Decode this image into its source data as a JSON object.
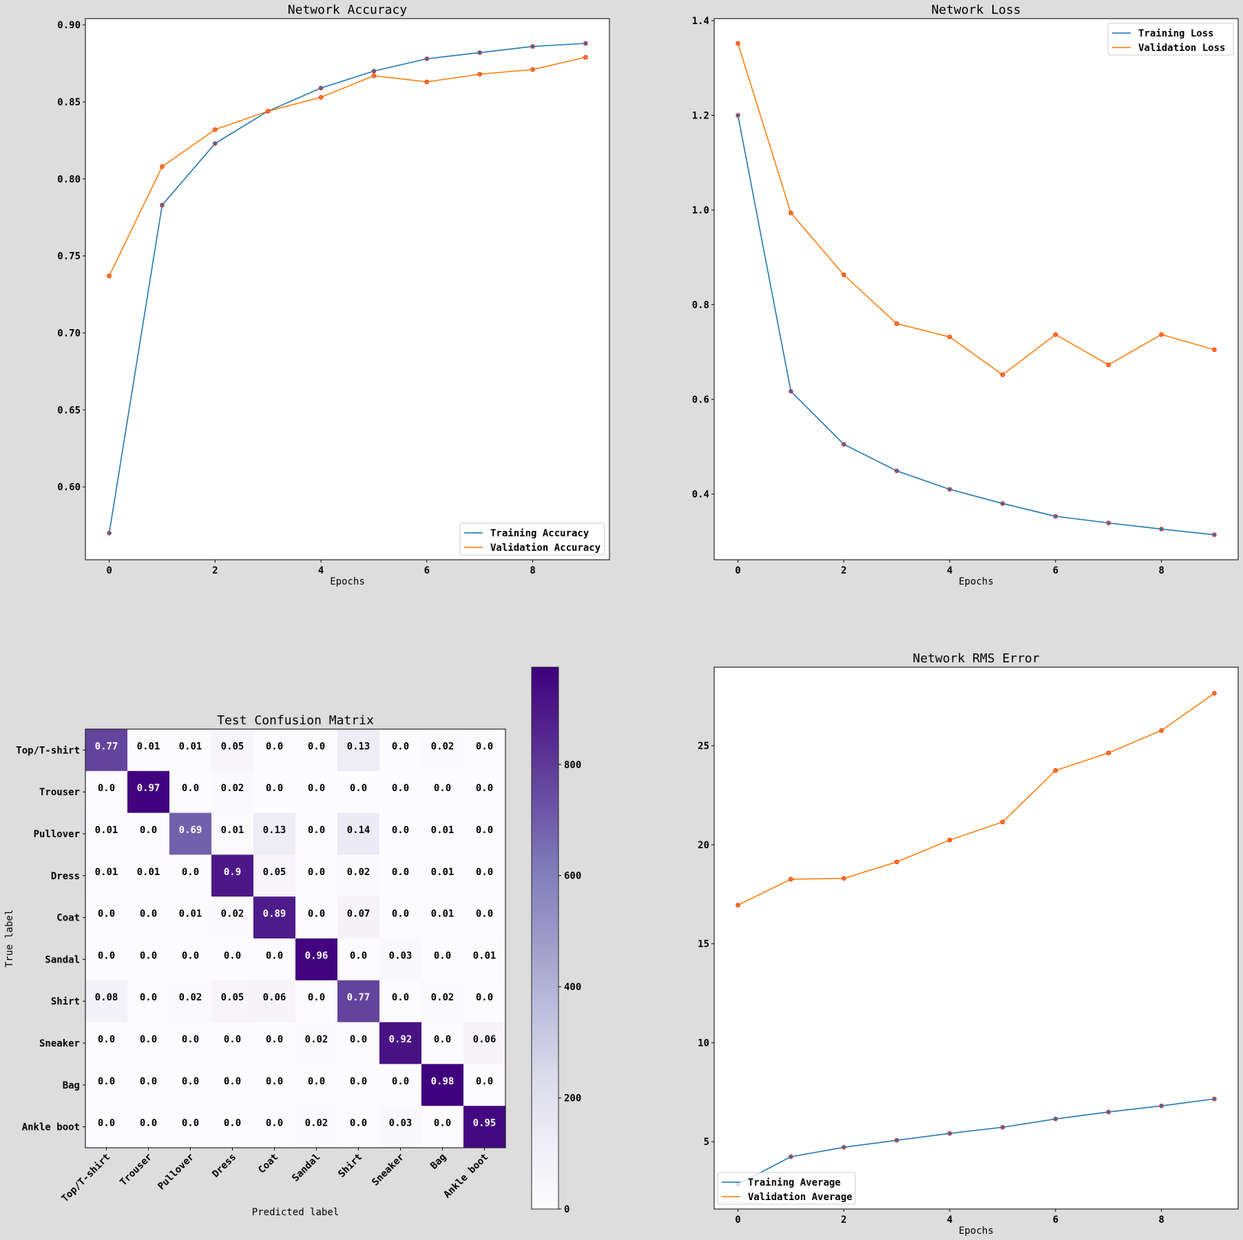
{
  "colors": {
    "background": "#dddddd",
    "training": "#1f77b4",
    "validation": "#ff7f0e",
    "marker": "#ff2a1a",
    "cmap_low": "#fcfbfd",
    "cmap_high": "#3f007d"
  },
  "chart_data": [
    {
      "id": "accuracy",
      "type": "line",
      "title": "Network Accuracy",
      "xlabel": "Epochs",
      "ylabel": "",
      "x": [
        0,
        1,
        2,
        3,
        4,
        5,
        6,
        7,
        8,
        9
      ],
      "xlim": [
        -0.45,
        9.45
      ],
      "ylim": [
        0.5527,
        0.9041
      ],
      "xticks": [
        0,
        2,
        4,
        6,
        8
      ],
      "yticks": [
        0.6,
        0.65,
        0.7,
        0.75,
        0.8,
        0.85,
        0.9
      ],
      "ytick_labels": [
        "0.60",
        "0.65",
        "0.70",
        "0.75",
        "0.80",
        "0.85",
        "0.90"
      ],
      "legend_position": "lower-right",
      "grid": false,
      "series": [
        {
          "name": "Training Accuracy",
          "color_key": "training",
          "values": [
            0.57,
            0.783,
            0.823,
            0.844,
            0.859,
            0.87,
            0.878,
            0.882,
            0.886,
            0.888
          ]
        },
        {
          "name": "Validation Accuracy",
          "color_key": "validation",
          "values": [
            0.737,
            0.808,
            0.832,
            0.844,
            0.853,
            0.867,
            0.863,
            0.868,
            0.871,
            0.879
          ]
        }
      ]
    },
    {
      "id": "loss",
      "type": "line",
      "title": "Network Loss",
      "xlabel": "Epochs",
      "ylabel": "",
      "x": [
        0,
        1,
        2,
        3,
        4,
        5,
        6,
        7,
        8,
        9
      ],
      "xlim": [
        -0.45,
        9.45
      ],
      "ylim": [
        0.2612,
        1.4044
      ],
      "xticks": [
        0,
        2,
        4,
        6,
        8
      ],
      "yticks": [
        0.4,
        0.6,
        0.8,
        1.0,
        1.2,
        1.4
      ],
      "ytick_labels": [
        "0.4",
        "0.6",
        "0.8",
        "1.0",
        "1.2",
        "1.4"
      ],
      "legend_position": "upper-right",
      "grid": false,
      "series": [
        {
          "name": "Training Loss",
          "color_key": "training",
          "values": [
            1.2,
            0.617,
            0.505,
            0.449,
            0.41,
            0.38,
            0.353,
            0.339,
            0.326,
            0.314
          ]
        },
        {
          "name": "Validation Loss",
          "color_key": "validation",
          "values": [
            1.352,
            0.994,
            0.863,
            0.76,
            0.732,
            0.652,
            0.737,
            0.673,
            0.737,
            0.705
          ]
        }
      ]
    },
    {
      "id": "rms",
      "type": "line",
      "title": "Network RMS Error",
      "xlabel": "Epochs",
      "ylabel": "",
      "x": [
        0,
        1,
        2,
        3,
        4,
        5,
        6,
        7,
        8,
        9
      ],
      "xlim": [
        -0.45,
        9.45
      ],
      "ylim": [
        1.6,
        28.97
      ],
      "xticks": [
        0,
        2,
        4,
        6,
        8
      ],
      "yticks": [
        5,
        10,
        15,
        20,
        25
      ],
      "ytick_labels": [
        "5",
        "10",
        "15",
        "20",
        "25"
      ],
      "legend_position": "lower-left",
      "grid": false,
      "series": [
        {
          "name": "Training Average",
          "color_key": "training",
          "values": [
            2.85,
            4.24,
            4.72,
            5.07,
            5.42,
            5.73,
            6.15,
            6.5,
            6.81,
            7.16
          ]
        },
        {
          "name": "Validation Average",
          "color_key": "validation",
          "values": [
            16.95,
            18.26,
            18.3,
            19.13,
            20.24,
            21.15,
            23.75,
            24.64,
            25.77,
            27.65
          ]
        }
      ]
    },
    {
      "id": "confusion",
      "type": "heatmap",
      "title": "Test Confusion Matrix",
      "xlabel": "Predicted label",
      "ylabel": "True label",
      "labels": [
        "Top/T-shirt",
        "Trouser",
        "Pullover",
        "Dress",
        "Coat",
        "Sandal",
        "Shirt",
        "Sneaker",
        "Bag",
        "Ankle boot"
      ],
      "matrix": [
        [
          "0.77",
          "0.01",
          "0.01",
          "0.05",
          "0.0",
          "0.0",
          "0.13",
          "0.0",
          "0.02",
          "0.0"
        ],
        [
          "0.0",
          "0.97",
          "0.0",
          "0.02",
          "0.0",
          "0.0",
          "0.0",
          "0.0",
          "0.0",
          "0.0"
        ],
        [
          "0.01",
          "0.0",
          "0.69",
          "0.01",
          "0.13",
          "0.0",
          "0.14",
          "0.0",
          "0.01",
          "0.0"
        ],
        [
          "0.01",
          "0.01",
          "0.0",
          "0.9",
          "0.05",
          "0.0",
          "0.02",
          "0.0",
          "0.01",
          "0.0"
        ],
        [
          "0.0",
          "0.0",
          "0.01",
          "0.02",
          "0.89",
          "0.0",
          "0.07",
          "0.0",
          "0.01",
          "0.0"
        ],
        [
          "0.0",
          "0.0",
          "0.0",
          "0.0",
          "0.0",
          "0.96",
          "0.0",
          "0.03",
          "0.0",
          "0.01"
        ],
        [
          "0.08",
          "0.0",
          "0.02",
          "0.05",
          "0.06",
          "0.0",
          "0.77",
          "0.0",
          "0.02",
          "0.0"
        ],
        [
          "0.0",
          "0.0",
          "0.0",
          "0.0",
          "0.0",
          "0.02",
          "0.0",
          "0.92",
          "0.0",
          "0.06"
        ],
        [
          "0.0",
          "0.0",
          "0.0",
          "0.0",
          "0.0",
          "0.0",
          "0.0",
          "0.0",
          "0.98",
          "0.0"
        ],
        [
          "0.0",
          "0.0",
          "0.0",
          "0.0",
          "0.0",
          "0.02",
          "0.0",
          "0.03",
          "0.0",
          "0.95"
        ]
      ],
      "colorbar": {
        "range": [
          0,
          975
        ],
        "ticks": [
          0,
          200,
          400,
          600,
          800
        ],
        "tick_labels": [
          "0",
          "200",
          "400",
          "600",
          "800"
        ]
      }
    }
  ]
}
